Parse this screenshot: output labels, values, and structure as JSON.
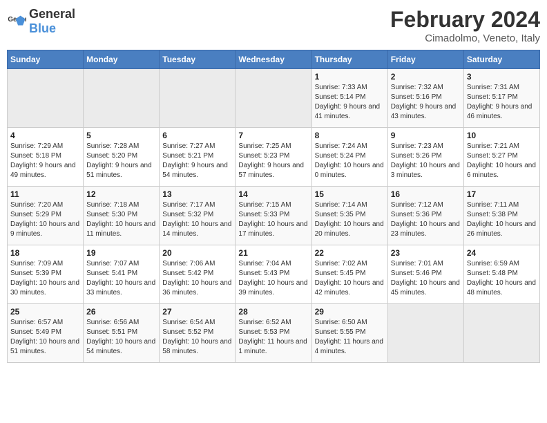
{
  "logo": {
    "general": "General",
    "blue": "Blue"
  },
  "title": "February 2024",
  "subtitle": "Cimadolmo, Veneto, Italy",
  "days_of_week": [
    "Sunday",
    "Monday",
    "Tuesday",
    "Wednesday",
    "Thursday",
    "Friday",
    "Saturday"
  ],
  "weeks": [
    [
      {
        "day": "",
        "empty": true
      },
      {
        "day": "",
        "empty": true
      },
      {
        "day": "",
        "empty": true
      },
      {
        "day": "",
        "empty": true
      },
      {
        "day": "1",
        "sunrise": "7:33 AM",
        "sunset": "5:14 PM",
        "daylight": "9 hours and 41 minutes."
      },
      {
        "day": "2",
        "sunrise": "7:32 AM",
        "sunset": "5:16 PM",
        "daylight": "9 hours and 43 minutes."
      },
      {
        "day": "3",
        "sunrise": "7:31 AM",
        "sunset": "5:17 PM",
        "daylight": "9 hours and 46 minutes."
      }
    ],
    [
      {
        "day": "4",
        "sunrise": "7:29 AM",
        "sunset": "5:18 PM",
        "daylight": "9 hours and 49 minutes."
      },
      {
        "day": "5",
        "sunrise": "7:28 AM",
        "sunset": "5:20 PM",
        "daylight": "9 hours and 51 minutes."
      },
      {
        "day": "6",
        "sunrise": "7:27 AM",
        "sunset": "5:21 PM",
        "daylight": "9 hours and 54 minutes."
      },
      {
        "day": "7",
        "sunrise": "7:25 AM",
        "sunset": "5:23 PM",
        "daylight": "9 hours and 57 minutes."
      },
      {
        "day": "8",
        "sunrise": "7:24 AM",
        "sunset": "5:24 PM",
        "daylight": "10 hours and 0 minutes."
      },
      {
        "day": "9",
        "sunrise": "7:23 AM",
        "sunset": "5:26 PM",
        "daylight": "10 hours and 3 minutes."
      },
      {
        "day": "10",
        "sunrise": "7:21 AM",
        "sunset": "5:27 PM",
        "daylight": "10 hours and 6 minutes."
      }
    ],
    [
      {
        "day": "11",
        "sunrise": "7:20 AM",
        "sunset": "5:29 PM",
        "daylight": "10 hours and 9 minutes."
      },
      {
        "day": "12",
        "sunrise": "7:18 AM",
        "sunset": "5:30 PM",
        "daylight": "10 hours and 11 minutes."
      },
      {
        "day": "13",
        "sunrise": "7:17 AM",
        "sunset": "5:32 PM",
        "daylight": "10 hours and 14 minutes."
      },
      {
        "day": "14",
        "sunrise": "7:15 AM",
        "sunset": "5:33 PM",
        "daylight": "10 hours and 17 minutes."
      },
      {
        "day": "15",
        "sunrise": "7:14 AM",
        "sunset": "5:35 PM",
        "daylight": "10 hours and 20 minutes."
      },
      {
        "day": "16",
        "sunrise": "7:12 AM",
        "sunset": "5:36 PM",
        "daylight": "10 hours and 23 minutes."
      },
      {
        "day": "17",
        "sunrise": "7:11 AM",
        "sunset": "5:38 PM",
        "daylight": "10 hours and 26 minutes."
      }
    ],
    [
      {
        "day": "18",
        "sunrise": "7:09 AM",
        "sunset": "5:39 PM",
        "daylight": "10 hours and 30 minutes."
      },
      {
        "day": "19",
        "sunrise": "7:07 AM",
        "sunset": "5:41 PM",
        "daylight": "10 hours and 33 minutes."
      },
      {
        "day": "20",
        "sunrise": "7:06 AM",
        "sunset": "5:42 PM",
        "daylight": "10 hours and 36 minutes."
      },
      {
        "day": "21",
        "sunrise": "7:04 AM",
        "sunset": "5:43 PM",
        "daylight": "10 hours and 39 minutes."
      },
      {
        "day": "22",
        "sunrise": "7:02 AM",
        "sunset": "5:45 PM",
        "daylight": "10 hours and 42 minutes."
      },
      {
        "day": "23",
        "sunrise": "7:01 AM",
        "sunset": "5:46 PM",
        "daylight": "10 hours and 45 minutes."
      },
      {
        "day": "24",
        "sunrise": "6:59 AM",
        "sunset": "5:48 PM",
        "daylight": "10 hours and 48 minutes."
      }
    ],
    [
      {
        "day": "25",
        "sunrise": "6:57 AM",
        "sunset": "5:49 PM",
        "daylight": "10 hours and 51 minutes."
      },
      {
        "day": "26",
        "sunrise": "6:56 AM",
        "sunset": "5:51 PM",
        "daylight": "10 hours and 54 minutes."
      },
      {
        "day": "27",
        "sunrise": "6:54 AM",
        "sunset": "5:52 PM",
        "daylight": "10 hours and 58 minutes."
      },
      {
        "day": "28",
        "sunrise": "6:52 AM",
        "sunset": "5:53 PM",
        "daylight": "11 hours and 1 minute."
      },
      {
        "day": "29",
        "sunrise": "6:50 AM",
        "sunset": "5:55 PM",
        "daylight": "11 hours and 4 minutes."
      },
      {
        "day": "",
        "empty": true
      },
      {
        "day": "",
        "empty": true
      }
    ]
  ],
  "labels": {
    "sunrise": "Sunrise:",
    "sunset": "Sunset:",
    "daylight": "Daylight:"
  }
}
